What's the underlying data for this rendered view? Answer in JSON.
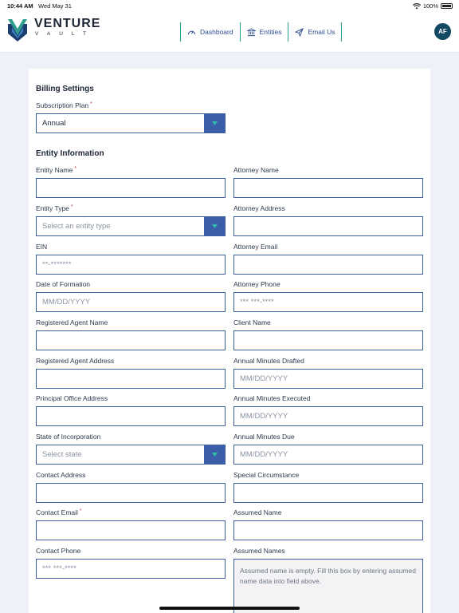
{
  "status_bar": {
    "time": "10:44 AM",
    "date": "Wed May 31",
    "battery": "100%"
  },
  "brand": {
    "name": "VENTURE",
    "sub": "VAULT"
  },
  "nav": {
    "dashboard": "Dashboard",
    "entities": "Entities",
    "email_us": "Email Us"
  },
  "user": {
    "initials": "AF"
  },
  "billing": {
    "title": "Billing Settings",
    "subscription_plan_label": "Subscription Plan",
    "subscription_plan_value": "Annual"
  },
  "entity": {
    "title": "Entity Information",
    "entity_name_label": "Entity Name",
    "entity_type_label": "Entity Type",
    "entity_type_placeholder": "Select an entity type",
    "ein_label": "EIN",
    "ein_placeholder": "**-*******",
    "date_of_formation_label": "Date of Formation",
    "date_placeholder": "MM/DD/YYYY",
    "registered_agent_name_label": "Registered Agent Name",
    "registered_agent_address_label": "Registered Agent Address",
    "principal_office_address_label": "Principal Office Address",
    "state_of_incorporation_label": "State of Incorporation",
    "state_placeholder": "Select state",
    "contact_address_label": "Contact Address",
    "contact_email_label": "Contact Email",
    "contact_phone_label": "Contact Phone",
    "phone_placeholder": "*** ***-****",
    "attorney_name_label": "Attorney Name",
    "attorney_address_label": "Attorney Address",
    "attorney_email_label": "Attorney Email",
    "attorney_phone_label": "Attorney Phone",
    "client_name_label": "Client Name",
    "annual_minutes_drafted_label": "Annual Minutes Drafted",
    "annual_minutes_executed_label": "Annual Minutes Executed",
    "annual_minutes_due_label": "Annual Minutes Due",
    "special_circumstance_label": "Special Circumstance",
    "assumed_name_label": "Assumed Name",
    "assumed_names_label": "Assumed Names",
    "assumed_names_placeholder": "Assumed name is empty. Fill this box by entering assumed name data into field above."
  },
  "colors": {
    "accent_blue": "#3b5ea8",
    "teal": "#2f9e8f",
    "required": "#d24444",
    "avatar": "#124a64"
  }
}
